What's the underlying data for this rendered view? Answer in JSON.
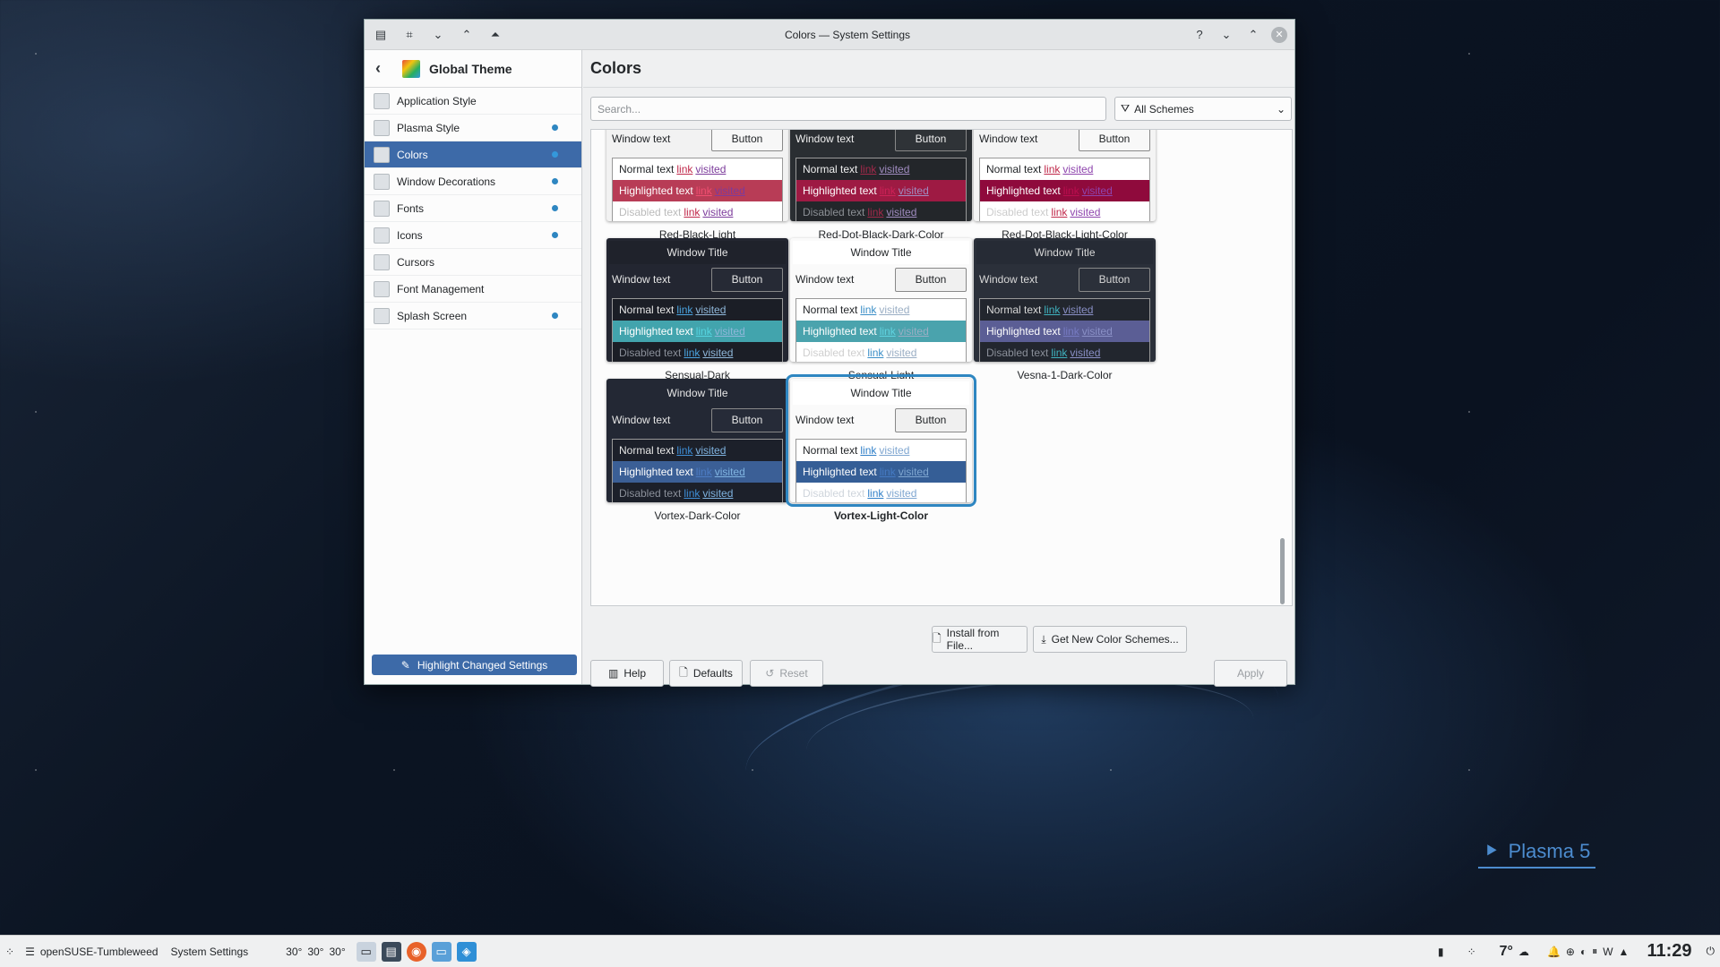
{
  "window": {
    "title": "Colors — System Settings"
  },
  "sidebar": {
    "back_label": "Global Theme",
    "items": [
      {
        "label": "Application Style",
        "changed": false,
        "selected": false
      },
      {
        "label": "Plasma Style",
        "changed": true,
        "selected": false
      },
      {
        "label": "Colors",
        "changed": true,
        "selected": true
      },
      {
        "label": "Window Decorations",
        "changed": true,
        "selected": false
      },
      {
        "label": "Fonts",
        "changed": true,
        "selected": false
      },
      {
        "label": "Icons",
        "changed": true,
        "selected": false
      },
      {
        "label": "Cursors",
        "changed": false,
        "selected": false
      },
      {
        "label": "Font Management",
        "changed": false,
        "selected": false
      },
      {
        "label": "Splash Screen",
        "changed": true,
        "selected": false
      }
    ],
    "highlight_button": "Highlight Changed Settings"
  },
  "main": {
    "title": "Colors",
    "search_placeholder": "Search...",
    "filter_label": "All Schemes",
    "preview_strings": {
      "window_title": "Window Title",
      "window_text": "Window text",
      "button": "Button",
      "normal": "Normal text",
      "highlighted": "Highlighted text",
      "disabled": "Disabled text",
      "link": "link",
      "visited": "visited"
    },
    "schemes": [
      {
        "name": "Red-Black-Light",
        "title_bg": "#ffffff",
        "title_fg": "#232629",
        "bg": "#f2f2f2",
        "fg": "#232629",
        "btn_bg": "#f7f7f7",
        "view_bg": "#ffffff",
        "view_fg": "#232629",
        "hl_bg": "#b83c56",
        "hl_fg": "#ffffff",
        "link": "#c0284a",
        "visited": "#7c3b9b",
        "dis": "#bbbbbb",
        "selected": false
      },
      {
        "name": "Red-Dot-Black-Dark-Color",
        "title_bg": "#2a2e32",
        "title_fg": "#eeeeee",
        "bg": "#2a2e32",
        "fg": "#eeeeee",
        "btn_bg": "#2f3337",
        "view_bg": "#23262a",
        "view_fg": "#eeeeee",
        "hl_bg": "#9e1a43",
        "hl_fg": "#ffffff",
        "link": "#a3294a",
        "visited": "#a08cc0",
        "dis": "#8b8f94",
        "selected": false
      },
      {
        "name": "Red-Dot-Black-Light-Color",
        "title_bg": "#ffffff",
        "title_fg": "#232629",
        "bg": "#f4f4f4",
        "fg": "#232629",
        "btn_bg": "#f8f8f8",
        "view_bg": "#ffffff",
        "view_fg": "#232629",
        "hl_bg": "#8f0a3c",
        "hl_fg": "#ffffff",
        "link": "#c0284a",
        "visited": "#8e44ad",
        "dis": "#cccccc",
        "selected": false
      },
      {
        "name": "Sensual-Dark",
        "title_bg": "#1f222b",
        "title_fg": "#e5e5e5",
        "bg": "#232631",
        "fg": "#e5e5e5",
        "btn_bg": "#262a35",
        "view_bg": "#1b1e26",
        "view_fg": "#e5e5e5",
        "hl_bg": "#42a4ad",
        "hl_fg": "#ffffff",
        "link": "#4aa3df",
        "visited": "#8fb7d9",
        "dis": "#8a8f99",
        "selected": false
      },
      {
        "name": "Sensual-Light",
        "title_bg": "#ffffff",
        "title_fg": "#232629",
        "bg": "#fafafa",
        "fg": "#232629",
        "btn_bg": "#f0f0f0",
        "view_bg": "#ffffff",
        "view_fg": "#232629",
        "hl_bg": "#4aa3ad",
        "hl_fg": "#ffffff",
        "link": "#3a8ec7",
        "visited": "#9aaec4",
        "dis": "#cfcfcf",
        "selected": false
      },
      {
        "name": "Vesna-1-Dark-Color",
        "title_bg": "#262b35",
        "title_fg": "#d8d8d8",
        "bg": "#2b303a",
        "fg": "#d8d8d8",
        "btn_bg": "#2b303a",
        "view_bg": "#22262e",
        "view_fg": "#d8d8d8",
        "hl_bg": "#5b5e95",
        "hl_fg": "#ffffff",
        "link": "#3fb3c0",
        "visited": "#8a90c6",
        "dis": "#8a8f99",
        "selected": false
      },
      {
        "name": "Vortex-Dark-Color",
        "title_bg": "#232834",
        "title_fg": "#e5e5e5",
        "bg": "#232834",
        "fg": "#e5e5e5",
        "btn_bg": "#262b38",
        "view_bg": "#1c202a",
        "view_fg": "#e5e5e5",
        "hl_bg": "#3b5f96",
        "hl_fg": "#ffffff",
        "link": "#3f8fd8",
        "visited": "#7fb3e0",
        "dis": "#8a8f99",
        "selected": false
      },
      {
        "name": "Vortex-Light-Color",
        "title_bg": "#ffffff",
        "title_fg": "#232629",
        "bg": "#fafafa",
        "fg": "#232629",
        "btn_bg": "#f0f0f0",
        "view_bg": "#ffffff",
        "view_fg": "#232629",
        "hl_bg": "#355e96",
        "hl_fg": "#ffffff",
        "link": "#2f7fc8",
        "visited": "#7fa6d0",
        "dis": "#cfd5dc",
        "selected": true
      }
    ],
    "buttons": {
      "install": "Install from File...",
      "get_new": "Get New Color Schemes...",
      "help": "Help",
      "defaults": "Defaults",
      "reset": "Reset",
      "apply": "Apply"
    }
  },
  "taskbar": {
    "app_title": "openSUSE-Tumbleweed",
    "app2": "System Settings",
    "temps": [
      "30°",
      "30°",
      "30°"
    ],
    "weather": "7°",
    "time": "11:29"
  },
  "desktop": {
    "plasma": "Plasma 5"
  }
}
